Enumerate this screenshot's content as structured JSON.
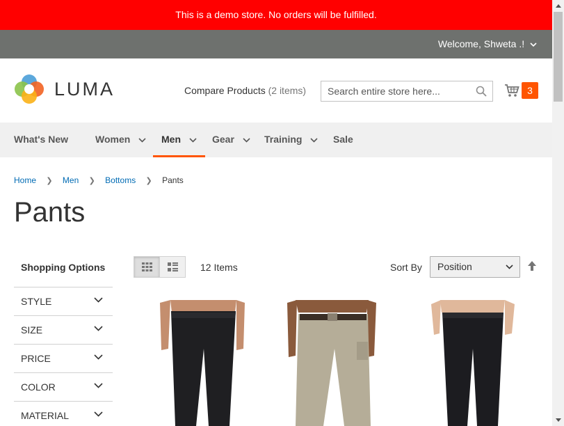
{
  "banner": {
    "text": "This is a demo store. No orders will be fulfilled."
  },
  "topbar": {
    "welcome": "Welcome, Shweta .!"
  },
  "header": {
    "logo_text": "LUMA",
    "compare_label": "Compare Products",
    "compare_count": "(2 items)",
    "search_placeholder": "Search entire store here...",
    "cart_count": "3"
  },
  "nav": {
    "items": [
      {
        "label": "What's New"
      },
      {
        "label": "Women"
      },
      {
        "label": "Men"
      },
      {
        "label": "Gear"
      },
      {
        "label": "Training"
      },
      {
        "label": "Sale"
      }
    ],
    "active": "Men"
  },
  "breadcrumbs": [
    "Home",
    "Men",
    "Bottoms",
    "Pants"
  ],
  "page_title": "Pants",
  "sidebar": {
    "title": "Shopping Options",
    "filters": [
      "STYLE",
      "SIZE",
      "PRICE",
      "COLOR",
      "MATERIAL"
    ]
  },
  "toolbar": {
    "amount": "12 Items",
    "sort_label": "Sort By",
    "sort_value": "Position"
  },
  "colors": {
    "banner": "#ff0000",
    "topbar": "#6e716e",
    "accent": "#ff5501",
    "link": "#006bb4"
  }
}
